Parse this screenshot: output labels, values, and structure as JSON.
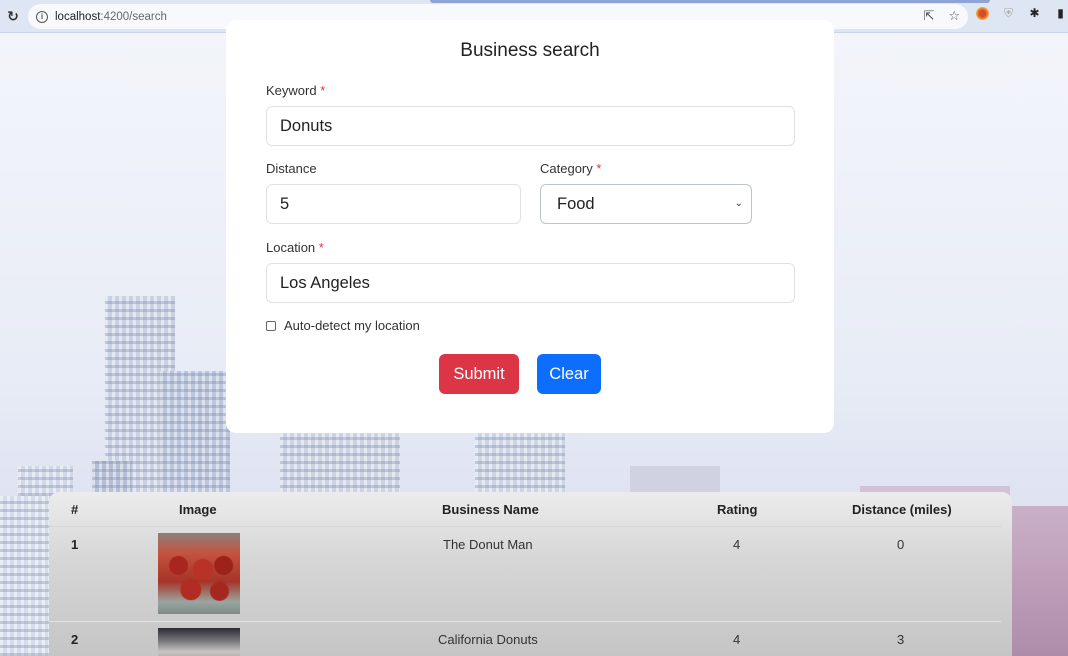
{
  "browser": {
    "url_host": "localhost",
    "url_path": ":4200/search",
    "icons": [
      "reload-icon",
      "site-info-icon",
      "share-icon",
      "bookmark-star-icon",
      "extension-icon",
      "shield-extension-icon",
      "puzzle-extensions-icon",
      "side-panel-icon"
    ]
  },
  "form": {
    "title": "Business search",
    "keyword": {
      "label": "Keyword",
      "required_mark": "*",
      "value": "Donuts"
    },
    "distance": {
      "label": "Distance",
      "value": "5"
    },
    "category": {
      "label": "Category",
      "required_mark": "*",
      "selected": "Food"
    },
    "location": {
      "label": "Location",
      "required_mark": "*",
      "value": "Los Angeles"
    },
    "auto_detect": {
      "label": "Auto-detect my location",
      "checked": false
    },
    "submit_label": "Submit",
    "clear_label": "Clear"
  },
  "results": {
    "columns": [
      "#",
      "Image",
      "Business Name",
      "Rating",
      "Distance (miles)"
    ],
    "rows": [
      {
        "index": "1",
        "name": "The Donut Man",
        "rating": "4",
        "distance": "0"
      },
      {
        "index": "2",
        "name": "California Donuts",
        "rating": "4",
        "distance": "3"
      }
    ]
  },
  "colors": {
    "submit": "#dc3545",
    "clear": "#0d6efd",
    "required": "#dc3545"
  }
}
